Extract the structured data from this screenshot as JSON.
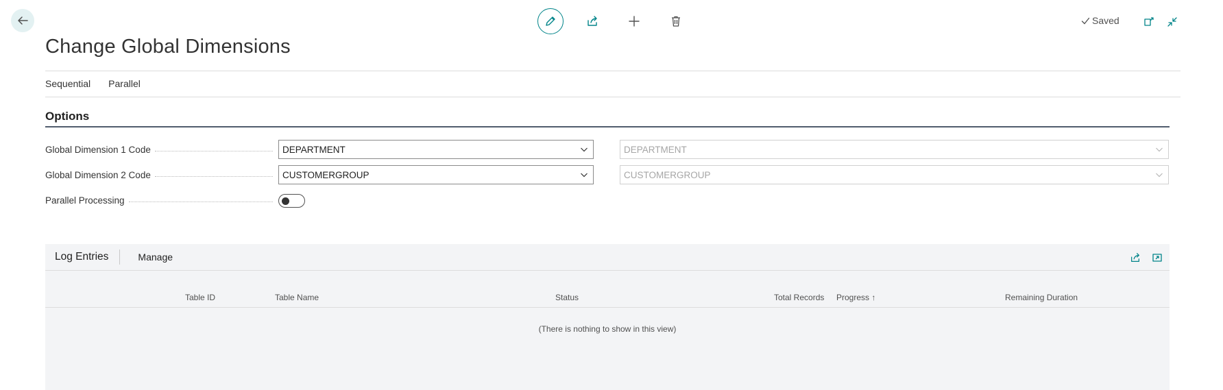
{
  "toolbar": {
    "back_icon": "arrow-left-icon",
    "actions": [
      {
        "name": "edit-button",
        "icon": "pencil-icon"
      },
      {
        "name": "share-button",
        "icon": "share-icon"
      },
      {
        "name": "new-button",
        "icon": "plus-icon"
      },
      {
        "name": "delete-button",
        "icon": "trash-icon"
      }
    ],
    "saved_label": "Saved",
    "open_new_window_icon": "open-in-new-window-icon",
    "collapse_icon": "collapse-icon"
  },
  "page": {
    "title": "Change Global Dimensions"
  },
  "subnav": {
    "items": [
      "Sequential",
      "Parallel"
    ]
  },
  "options": {
    "title": "Options",
    "fields": [
      {
        "label": "Global Dimension 1 Code",
        "value": "DEPARTMENT",
        "current_value": "DEPARTMENT"
      },
      {
        "label": "Global Dimension 2 Code",
        "value": "CUSTOMERGROUP",
        "current_value": "CUSTOMERGROUP"
      }
    ],
    "parallel_processing": {
      "label": "Parallel Processing",
      "enabled": false
    }
  },
  "log_entries": {
    "title": "Log Entries",
    "manage_label": "Manage",
    "columns": [
      "Table ID",
      "Table Name",
      "Status",
      "Total Records",
      "Progress ↑",
      "Remaining Duration"
    ],
    "empty_message": "(There is nothing to show in this view)"
  },
  "colors": {
    "accent": "#008489",
    "back_button_bg": "#e3f1f2",
    "panel_bg": "#f3f4f6"
  }
}
